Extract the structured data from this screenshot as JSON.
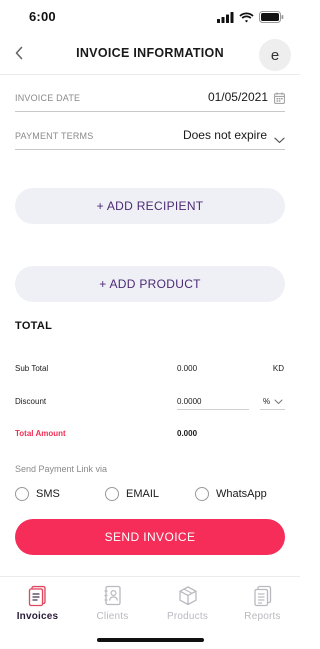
{
  "status_bar": {
    "time": "6:00"
  },
  "nav": {
    "title": "INVOICE INFORMATION",
    "avatar_letter": "e"
  },
  "fields": {
    "invoice_date": {
      "label": "INVOICE DATE",
      "value": "01/05/2021"
    },
    "payment_terms": {
      "label": "PAYMENT TERMS",
      "value": "Does not expire"
    }
  },
  "actions": {
    "add_recipient": "+ ADD RECIPIENT",
    "add_product": "+ ADD PRODUCT"
  },
  "totals": {
    "heading": "TOTAL",
    "sub_total_label": "Sub Total",
    "sub_total_value": "0.000",
    "currency": "KD",
    "discount_label": "Discount",
    "discount_value": "0.0000",
    "discount_unit": "%",
    "total_amount_label": "Total Amount",
    "total_amount_value": "0.000"
  },
  "send_link": {
    "label": "Send Payment Link via",
    "options": [
      "SMS",
      "EMAIL",
      "WhatsApp"
    ]
  },
  "send_button": "SEND INVOICE",
  "tabs": [
    {
      "label": "Invoices",
      "icon": "invoice-icon",
      "active": true
    },
    {
      "label": "Clients",
      "icon": "contacts-icon",
      "active": false
    },
    {
      "label": "Products",
      "icon": "box-icon",
      "active": false
    },
    {
      "label": "Reports",
      "icon": "report-icon",
      "active": false
    }
  ],
  "colors": {
    "accent": "#f52d58",
    "purple_text": "#4c2a73",
    "pill_bg": "#eef0f6",
    "active_tab_icon": "#e0465f"
  }
}
